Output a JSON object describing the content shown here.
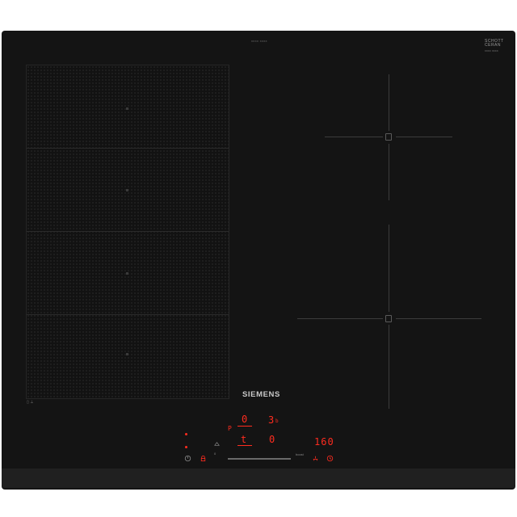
{
  "hob": {
    "brand": "SIEMENS",
    "glass_brand": [
      "SCHOTT",
      "CERAN"
    ],
    "glass_code": "xxxx xxxx",
    "top_code": "xxxx xxxx",
    "zone_symbols": [
      "|||",
      "|||"
    ]
  },
  "display": {
    "zone_a_level": "0",
    "zone_b_level": "3",
    "zone_b_sub": "b",
    "zone_c_level": "t",
    "zone_d_level": "0",
    "temperature": "160",
    "indicator_left": "P"
  },
  "icons": {
    "power": "power-icon",
    "child_lock": "lock-icon",
    "flex": "flex-icon",
    "timer": "timer-icon",
    "roast_sensor": "pan-icon",
    "boost": "boost-icon",
    "clock": "clock-icon"
  },
  "colors": {
    "glass": "#141414",
    "display_red": "#ff2c1f",
    "brand_text": "#c9c9c9"
  }
}
